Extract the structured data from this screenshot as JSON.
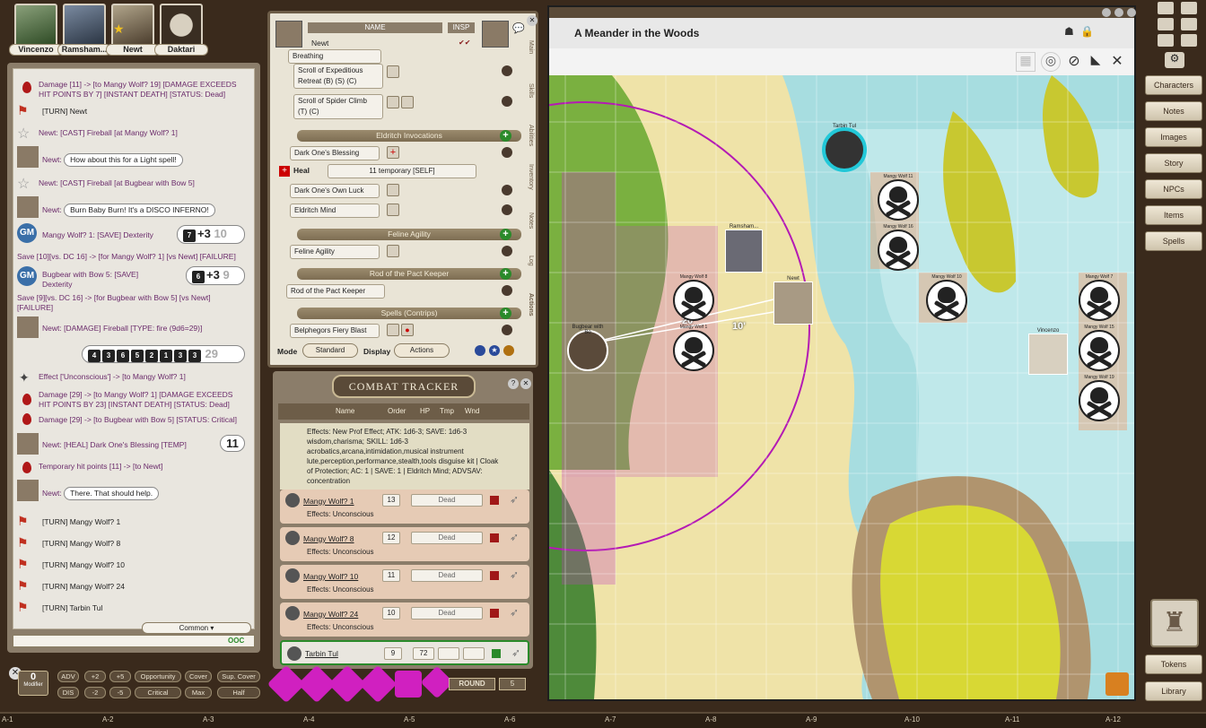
{
  "party": [
    {
      "name": "Vincenzo",
      "color": "#3a7a3a"
    },
    {
      "name": "Ramsham...",
      "color": "#4a5a7a"
    },
    {
      "name": "Newt",
      "color": "#6a5a4a"
    },
    {
      "name": "Daktari",
      "color": "#5a4a3a"
    }
  ],
  "chat": {
    "lines": [
      {
        "type": "blood",
        "text": "Damage [11] -> [to Mangy Wolf? 19] [DAMAGE EXCEEDS HIT POINTS BY 7] [INSTANT DEATH] [STATUS: Dead]"
      },
      {
        "type": "turn",
        "text": "[TURN] Newt"
      },
      {
        "type": "cast",
        "speaker": "Newt:",
        "text": "[CAST] Fireball [at Mangy Wolf? 1]"
      },
      {
        "type": "say",
        "speaker": "Newt:",
        "text": "How about this for a Light spell!"
      },
      {
        "type": "cast",
        "speaker": "Newt:",
        "text": "[CAST] Fireball [at Bugbear with Bow 5]"
      },
      {
        "type": "say",
        "speaker": "Newt:",
        "text": "Burn Baby Burn! It's a DISCO INFERNO!"
      },
      {
        "type": "gmsave",
        "text": "Mangy Wolf? 1:  [SAVE] Dexterity",
        "die": "7",
        "mod": "+3",
        "total": "10"
      },
      {
        "type": "plain",
        "text": "Save [10][vs. DC 16] -> [for Mangy Wolf? 1] [vs Newt] [FAILURE]"
      },
      {
        "type": "gmsave",
        "text": "Bugbear with Bow 5:  [SAVE] Dexterity",
        "die": "6",
        "mod": "+3",
        "total": "9"
      },
      {
        "type": "plain",
        "text": "Save [9][vs. DC 16] -> [for Bugbear with Bow 5] [vs Newt] [FAILURE]"
      },
      {
        "type": "dmg",
        "speaker": "Newt:",
        "text": "[DAMAGE] Fireball [TYPE: fire (9d6=29)]",
        "dice": [
          "4",
          "3",
          "6",
          "5",
          "2",
          "1",
          "3",
          "3"
        ],
        "total": "29"
      },
      {
        "type": "effect",
        "text": "Effect ['Unconscious'] -> [to Mangy Wolf? 1]"
      },
      {
        "type": "blood",
        "text": "Damage [29] -> [to Mangy Wolf? 1] [DAMAGE EXCEEDS HIT POINTS BY 23] [INSTANT DEATH] [STATUS: Dead]"
      },
      {
        "type": "blood",
        "text": "Damage [29] -> [to Bugbear with Bow 5] [STATUS: Critical]"
      },
      {
        "type": "heal",
        "speaker": "Newt:",
        "text": "[HEAL] Dark One's Blessing [TEMP]",
        "total": "11"
      },
      {
        "type": "blood",
        "text": "Temporary hit points [11] -> [to Newt]"
      },
      {
        "type": "say",
        "speaker": "Newt:",
        "text": "There. That should help."
      },
      {
        "type": "turn",
        "text": "[TURN] Mangy Wolf? 1"
      },
      {
        "type": "turn",
        "text": "[TURN] Mangy Wolf? 8"
      },
      {
        "type": "turn",
        "text": "[TURN] Mangy Wolf? 10"
      },
      {
        "type": "turn",
        "text": "[TURN] Mangy Wolf? 24"
      },
      {
        "type": "turn",
        "text": "[TURN] Tarbin Tul"
      }
    ],
    "language": "Common",
    "ooc": "OOC"
  },
  "sheet": {
    "col_name": "NAME",
    "col_insp": "INSP",
    "char_name": "Newt",
    "top_items": [
      "Breathing"
    ],
    "scrolls": [
      {
        "l1": "Scroll of Expeditious",
        "l2": "Retreat (B) (S) (C)"
      },
      {
        "l1": "Scroll of Spider Climb",
        "l2": "(T) (C)"
      }
    ],
    "sections": {
      "invocations": "Eldritch Invocations",
      "agility": "Feline Agility",
      "rod": "Rod of the Pact Keeper",
      "cantrips": "Spells (Contrips)"
    },
    "invocations": [
      "Dark One's Blessing",
      "Dark One's Own Luck",
      "Eldritch Mind"
    ],
    "heal": {
      "label": "Heal",
      "value": "11 temporary [SELF]"
    },
    "agility_items": [
      "Feline Agility"
    ],
    "rod_items": [
      "Rod of the Pact Keeper"
    ],
    "cantrip_items": [
      "Belphegors Fiery Blast"
    ],
    "mode_label": "Mode",
    "mode_value": "Standard",
    "display_label": "Display",
    "display_value": "Actions",
    "tabs": [
      "Main",
      "Skills",
      "Abilities",
      "Inventory",
      "Notes",
      "Log",
      "Actions"
    ]
  },
  "combat": {
    "title": "COMBAT TRACKER",
    "cols": [
      "Name",
      "Order",
      "HP",
      "Tmp",
      "Wnd"
    ],
    "effects_text": "Effects: New Prof Effect; ATK: 1d6-3; SAVE: 1d6-3 wisdom,charisma; SKILL: 1d6-3 acrobatics,arcana,intimidation,musical instrument lute,perception,performance,stealth,tools disguise kit | Cloak of Protection; AC: 1 | SAVE: 1 | Eldritch Mind; ADVSAV: concentration",
    "rows": [
      {
        "name": "Mangy Wolf? 1",
        "order": "13",
        "status": "Dead",
        "effects": "Effects: Unconscious"
      },
      {
        "name": "Mangy Wolf? 8",
        "order": "12",
        "status": "Dead",
        "effects": "Effects: Unconscious"
      },
      {
        "name": "Mangy Wolf? 10",
        "order": "11",
        "status": "Dead",
        "effects": "Effects: Unconscious"
      },
      {
        "name": "Mangy Wolf? 24",
        "order": "10",
        "status": "Dead",
        "effects": "Effects: Unconscious"
      }
    ],
    "active": {
      "name": "Tarbin Tul",
      "order": "9",
      "hp": "72"
    },
    "round_label": "ROUND",
    "round": "5"
  },
  "map": {
    "title": "A Meander in the Woods",
    "tokens": {
      "tarbin": "Tarbin Tul",
      "ramsham": "Ramsham...",
      "newt": "Newt",
      "bugbear": "Bugbear with Bo",
      "vincenzo": "Vincenzo"
    },
    "wolf_labels": [
      "Mangy Wolf",
      "Mangy Wolf",
      "Mangy Wolf",
      "Mangy Wolf",
      "Mangy Wolf",
      "Mangy Wolf",
      "Mangy Wolf",
      "Mangy Wolf",
      "Mangy Wolf"
    ],
    "wolf_numbers": [
      "11",
      "16",
      "8",
      "1",
      "10",
      "7",
      "15",
      "19",
      "24"
    ],
    "dist1": "20'",
    "dist2": "10'"
  },
  "sidebar": [
    "Characters",
    "Notes",
    "Images",
    "Story",
    "NPCs",
    "Items",
    "Spells"
  ],
  "sidebar_bottom": [
    "Tokens",
    "Library"
  ],
  "bottom": {
    "modifier_value": "0",
    "modifier_label": "Modifier",
    "buttons_row1": [
      "ADV",
      "+2",
      "+5",
      "Opportunity",
      "Cover",
      "Sup. Cover"
    ],
    "buttons_row2": [
      "DIS",
      "-2",
      "-5",
      "Critical",
      "Max",
      "Half"
    ],
    "dice": [
      "d4",
      "d6",
      "d8",
      "d10",
      "d12",
      "d20"
    ]
  },
  "ruler": [
    "A-1",
    "A-2",
    "A-3",
    "A-4",
    "A-5",
    "A-6",
    "A-7",
    "A-8",
    "A-9",
    "A-10",
    "A-11",
    "A-12"
  ]
}
